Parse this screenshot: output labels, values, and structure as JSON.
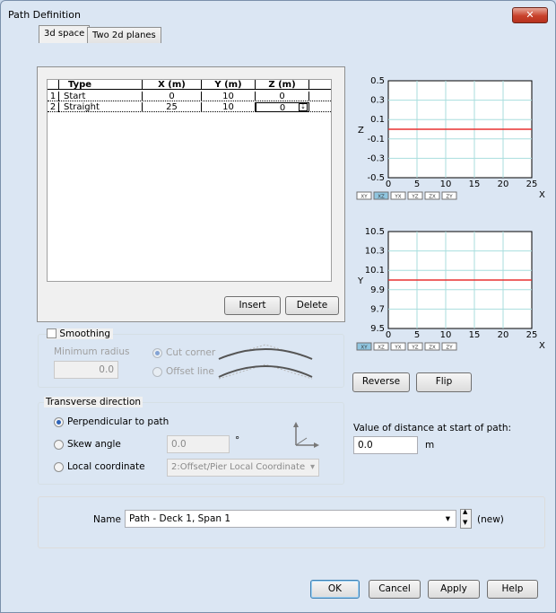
{
  "window": {
    "title": "Path Definition",
    "close_label": "✕"
  },
  "tabs": [
    {
      "label": "3d space"
    },
    {
      "label": "Two 2d planes"
    }
  ],
  "grid": {
    "columns": [
      "",
      "Type",
      "X (m)",
      "Y (m)",
      "Z (m)"
    ],
    "rows": [
      {
        "index": "1",
        "type": "Start",
        "x": "0",
        "y": "10",
        "z": "0"
      },
      {
        "index": "2",
        "type": "Straight",
        "x": "25",
        "y": "10",
        "z": "0"
      }
    ]
  },
  "buttons": {
    "insert": "Insert",
    "delete": "Delete",
    "reverse": "Reverse",
    "flip": "Flip",
    "ok": "OK",
    "cancel": "Cancel",
    "apply": "Apply",
    "help": "Help"
  },
  "smoothing": {
    "label": "Smoothing",
    "min_radius_label": "Minimum radius",
    "min_radius_value": "0.0",
    "cut_corner": "Cut corner",
    "offset_line": "Offset line"
  },
  "transverse": {
    "label": "Transverse direction",
    "perpendicular": "Perpendicular to path",
    "skew_angle": "Skew angle",
    "skew_value": "0.0",
    "degree_unit": "°",
    "local_coordinate": "Local coordinate",
    "local_value": "2:Offset/Pier Local Coordinate"
  },
  "distance": {
    "label": "Value of distance at start of path:",
    "value": "0.0",
    "unit": "m"
  },
  "name": {
    "label": "Name",
    "value": "Path - Deck 1, Span 1",
    "suffix": "(new)"
  },
  "planes": [
    "XY",
    "XZ",
    "YX",
    "YZ",
    "ZX",
    "ZY"
  ],
  "chart_data": [
    {
      "type": "line",
      "xlabel": "X",
      "ylabel": "Z",
      "xlim": [
        0,
        25
      ],
      "ylim": [
        -0.5,
        0.5
      ],
      "xticks": [
        "0",
        "5",
        "10",
        "15",
        "20",
        "25"
      ],
      "yticks": [
        "0.5",
        "0.3",
        "0.1",
        "-0.1",
        "-0.3",
        "-0.5"
      ],
      "series": [
        {
          "x": [
            0,
            25
          ],
          "y": [
            0,
            0
          ],
          "color": "#e83030"
        }
      ],
      "active_plane": "XZ"
    },
    {
      "type": "line",
      "xlabel": "X",
      "ylabel": "Y",
      "xlim": [
        0,
        25
      ],
      "ylim": [
        9.5,
        10.5
      ],
      "xticks": [
        "0",
        "5",
        "10",
        "15",
        "20",
        "25"
      ],
      "yticks": [
        "10.5",
        "10.3",
        "10.1",
        "9.9",
        "9.7",
        "9.5"
      ],
      "series": [
        {
          "x": [
            0,
            25
          ],
          "y": [
            10,
            10
          ],
          "color": "#e83030"
        }
      ],
      "active_plane": "XY"
    }
  ]
}
